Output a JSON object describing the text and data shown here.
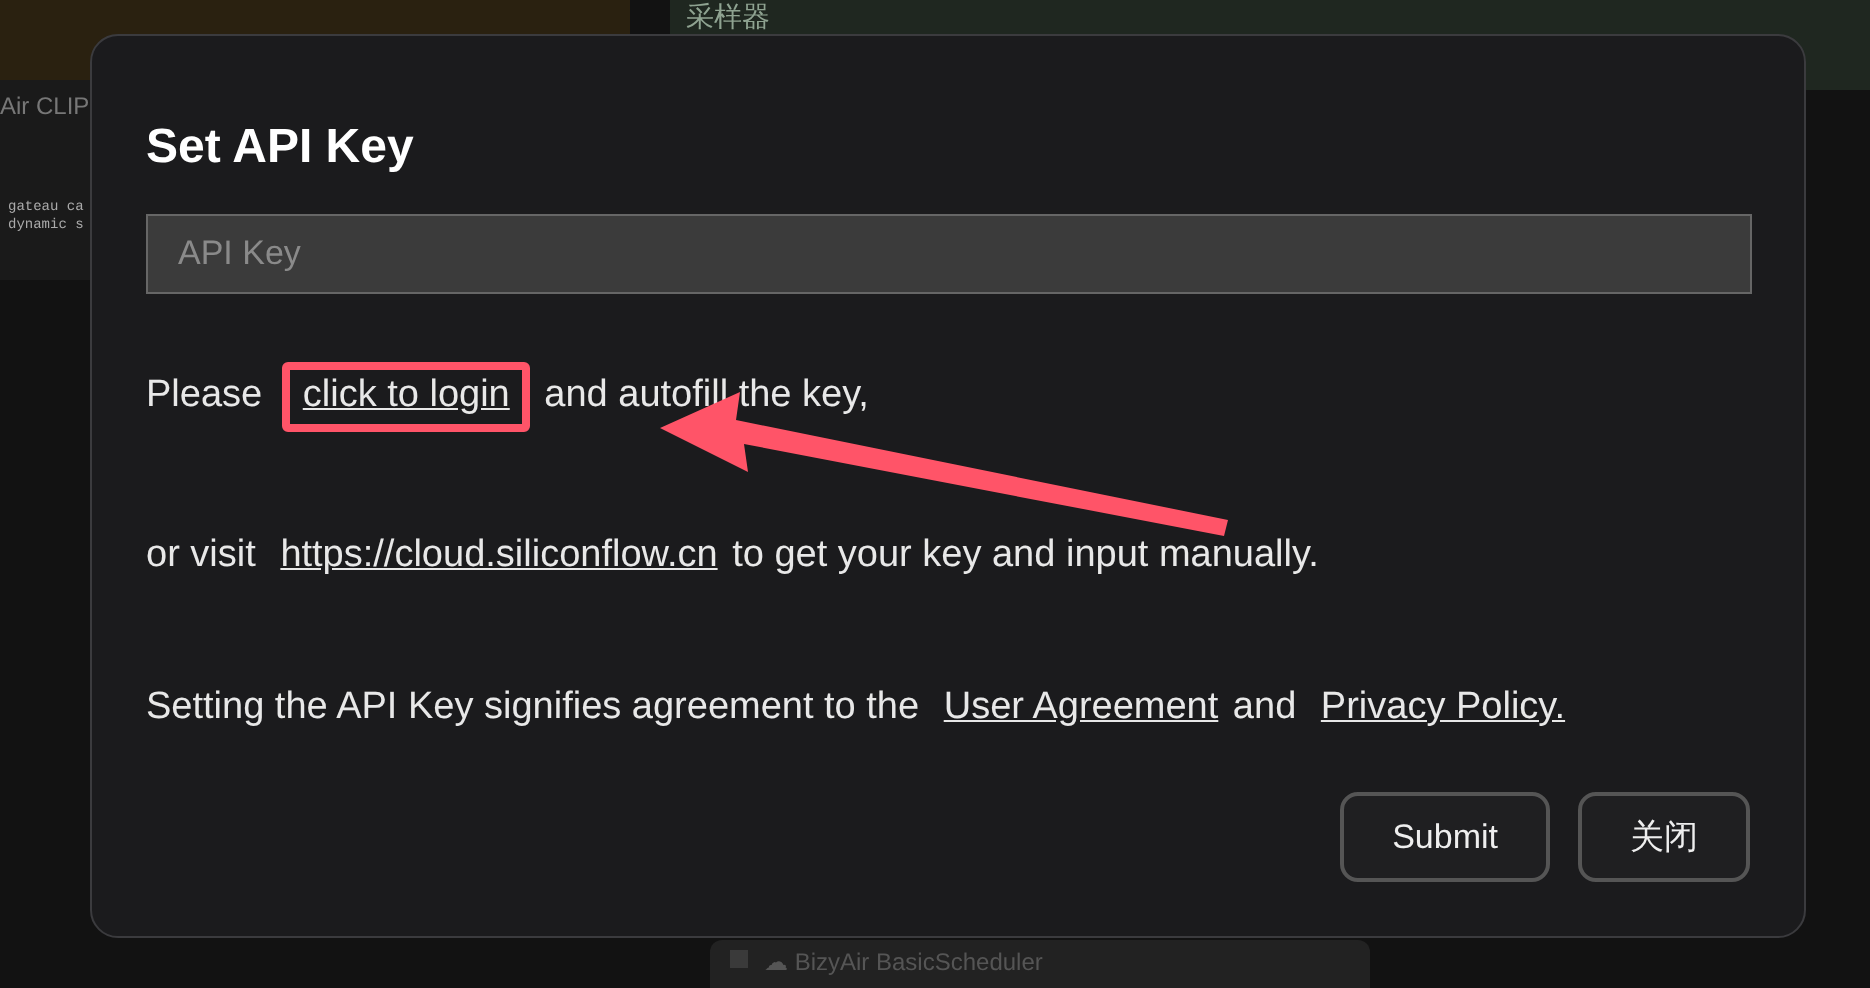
{
  "background": {
    "nodes": [
      {
        "kind": "title-node",
        "title": "采样器"
      },
      {
        "kind": "label-node",
        "title": "Air CLIP"
      },
      {
        "kind": "text-node",
        "lines": [
          "gateau ca",
          "dynamic s"
        ]
      },
      {
        "kind": "option-node",
        "title": "☁ BizyAir BasicScheduler",
        "checked": false
      }
    ]
  },
  "dialog": {
    "title": "Set API Key",
    "input": {
      "placeholder": "API Key"
    },
    "paragraphs": [
      {
        "parts": [
          {
            "kind": "text",
            "text": "Please "
          },
          {
            "kind": "link",
            "text": "click to login",
            "highlighted": true
          },
          {
            "kind": "text",
            "text": " and autofill the key,"
          }
        ]
      },
      {
        "parts": [
          {
            "kind": "text",
            "text": "or visit "
          },
          {
            "kind": "link",
            "text": "https://cloud.siliconflow.cn",
            "highlighted": false
          },
          {
            "kind": "text",
            "text": " to get your key and input manually."
          }
        ]
      },
      {
        "parts": [
          {
            "kind": "text",
            "text": "Setting the API Key signifies agreement to the "
          },
          {
            "kind": "link",
            "text": "User Agreement",
            "highlighted": false
          },
          {
            "kind": "text",
            "text": " and "
          },
          {
            "kind": "link",
            "text": "Privacy Policy.",
            "highlighted": false
          }
        ]
      }
    ],
    "buttons": [
      {
        "label": "Submit"
      },
      {
        "label": "关闭"
      }
    ]
  },
  "annotation": {
    "kind": "arrow",
    "color": "#ff5468"
  }
}
